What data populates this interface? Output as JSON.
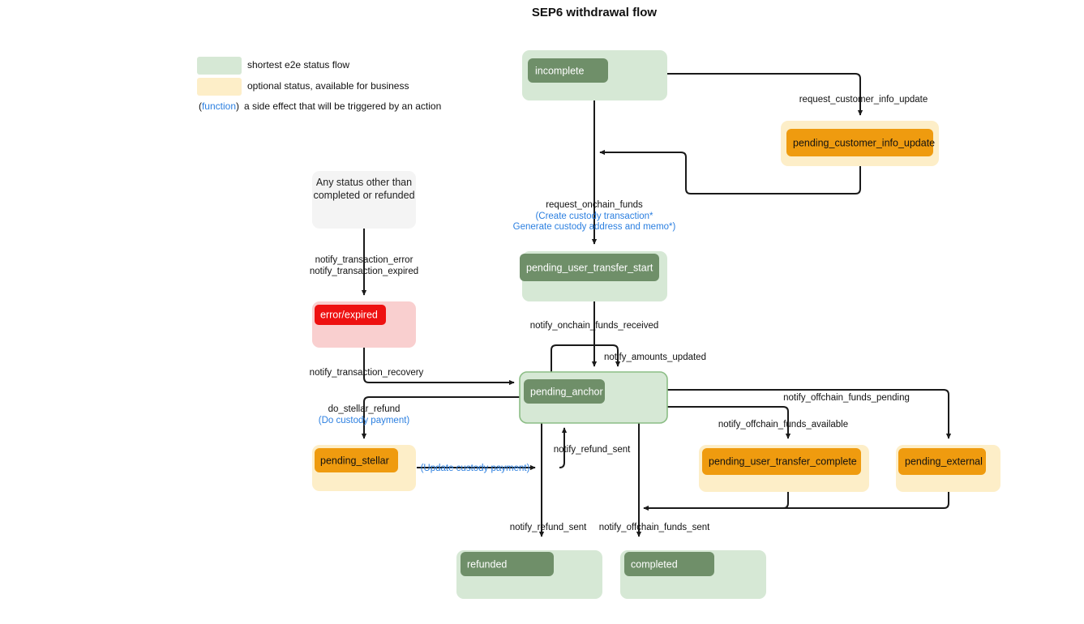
{
  "title": "SEP6 withdrawal flow",
  "colors": {
    "green_outer": "#d6e8d5",
    "green_inner": "#6f8f69",
    "green_border": "#8bbd85",
    "orange_outer": "#fdeec8",
    "orange_inner": "#ef9b0f",
    "red_outer": "#f9cfcf",
    "red_inner": "#ee1111",
    "grey_outer": "#f4f4f4",
    "edge": "#1a1a1a",
    "function_text": "#2b7fe0",
    "text": "#111111"
  },
  "legend": {
    "items": [
      {
        "swatch": "green_outer",
        "label": "shortest e2e status flow"
      },
      {
        "swatch": "orange_outer",
        "label": "optional status, available for business"
      }
    ],
    "function_row": {
      "open_paren": "(",
      "keyword": "function",
      "close_paren": ")",
      "label": "a side effect that will be triggered by an action"
    }
  },
  "nodes": {
    "incomplete": {
      "label": "incomplete",
      "kind": "green"
    },
    "pending_customer_info_update": {
      "label": "pending_customer_info_update",
      "kind": "orange"
    },
    "pending_user_transfer_start": {
      "label": "pending_user_transfer_start",
      "kind": "green"
    },
    "pending_anchor": {
      "label": "pending_anchor",
      "kind": "green-outlined"
    },
    "pending_stellar": {
      "label": "pending_stellar",
      "kind": "orange"
    },
    "pending_user_transfer_complete": {
      "label": "pending_user_transfer_complete",
      "kind": "orange"
    },
    "pending_external": {
      "label": "pending_external",
      "kind": "orange"
    },
    "error_expired": {
      "label": "error/expired",
      "kind": "red"
    },
    "refunded": {
      "label": "refunded",
      "kind": "green"
    },
    "completed": {
      "label": "completed",
      "kind": "green"
    },
    "any_status": {
      "label_line1": "Any status other than",
      "label_line2": "completed or refunded",
      "kind": "grey"
    }
  },
  "edges": [
    {
      "id": "e-request-customer-info-update",
      "label": "request_customer_info_update",
      "from": "incomplete",
      "to": "pending_customer_info_update"
    },
    {
      "id": "e-customer-info-back",
      "label": "",
      "from": "pending_customer_info_update",
      "to": "incomplete"
    },
    {
      "id": "e-request-onchain-funds",
      "label": "request_onchain_funds",
      "fn_line1": "(Create custody transaction*",
      "fn_line2": "Generate custody address and memo*)",
      "from": "incomplete",
      "to": "pending_user_transfer_start"
    },
    {
      "id": "e-notify-onchain-funds-received",
      "label": "notify_onchain_funds_received",
      "from": "pending_user_transfer_start",
      "to": "pending_anchor"
    },
    {
      "id": "e-notify-amounts-updated",
      "label": "notify_amounts_updated",
      "from": "pending_anchor",
      "to": "pending_anchor"
    },
    {
      "id": "e-notify-transaction-error",
      "label_line1": "notify_transaction_error",
      "label_line2": "notify_transaction_expired",
      "from": "any_status",
      "to": "error_expired"
    },
    {
      "id": "e-notify-transaction-recovery",
      "label": "notify_transaction_recovery",
      "from": "error_expired",
      "to": "pending_anchor"
    },
    {
      "id": "e-do-stellar-refund",
      "label": "do_stellar_refund",
      "fn_line1": "(Do custody payment)",
      "from": "pending_anchor",
      "to": "pending_stellar"
    },
    {
      "id": "e-update-custody-payment",
      "fn_line1": "(Update custody payment)",
      "from": "pending_stellar",
      "to": "notify_refund_sent_junction"
    },
    {
      "id": "e-notify-refund-sent-up",
      "label": "notify_refund_sent",
      "from": "pending_stellar",
      "to": "pending_anchor"
    },
    {
      "id": "e-notify-refund-sent-down",
      "label": "notify_refund_sent",
      "from": "pending_anchor",
      "to": "refunded"
    },
    {
      "id": "e-notify-offchain-funds-pending",
      "label": "notify_offchain_funds_pending",
      "from": "pending_anchor",
      "to": "pending_external"
    },
    {
      "id": "e-notify-offchain-funds-available",
      "label": "notify_offchain_funds_available",
      "from": "pending_anchor",
      "to": "pending_user_transfer_complete"
    },
    {
      "id": "e-notify-offchain-funds-sent",
      "label": "notify_offchain_funds_sent",
      "from": "pending_anchor",
      "to": "completed"
    },
    {
      "id": "e-external-to-completed",
      "label": "",
      "from": "pending_external",
      "to": "completed"
    },
    {
      "id": "e-user-transfer-complete-to-completed",
      "label": "",
      "from": "pending_user_transfer_complete",
      "to": "completed"
    }
  ]
}
